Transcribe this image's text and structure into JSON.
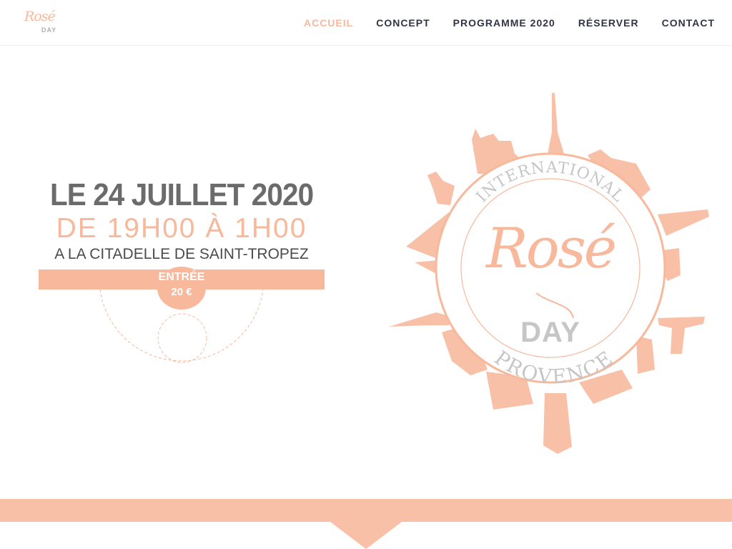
{
  "logo": {
    "script": "Rosé",
    "day": "DAY"
  },
  "nav": {
    "items": [
      {
        "label": "ACCUEIL",
        "active": true
      },
      {
        "label": "CONCEPT",
        "active": false
      },
      {
        "label": "PROGRAMME 2020",
        "active": false
      },
      {
        "label": "RÉSERVER",
        "active": false
      },
      {
        "label": "CONTACT",
        "active": false
      }
    ]
  },
  "hero": {
    "date": "LE 24 JUILLET 2020",
    "time": "DE 19H00 À 1H00",
    "place": "A LA CITADELLE DE SAINT-TROPEZ",
    "entry_label": "ENTRÉE",
    "entry_price": "20 €"
  },
  "emblem": {
    "top_text": "INTERNATIONAL",
    "script": "Rosé",
    "day": "DAY",
    "bottom_text": "PROVENCE"
  },
  "colors": {
    "accent": "#f7b89c",
    "nav_text": "#2f3547",
    "date_text": "#6b6b6b",
    "emblem_gray": "#c6c6c6"
  }
}
